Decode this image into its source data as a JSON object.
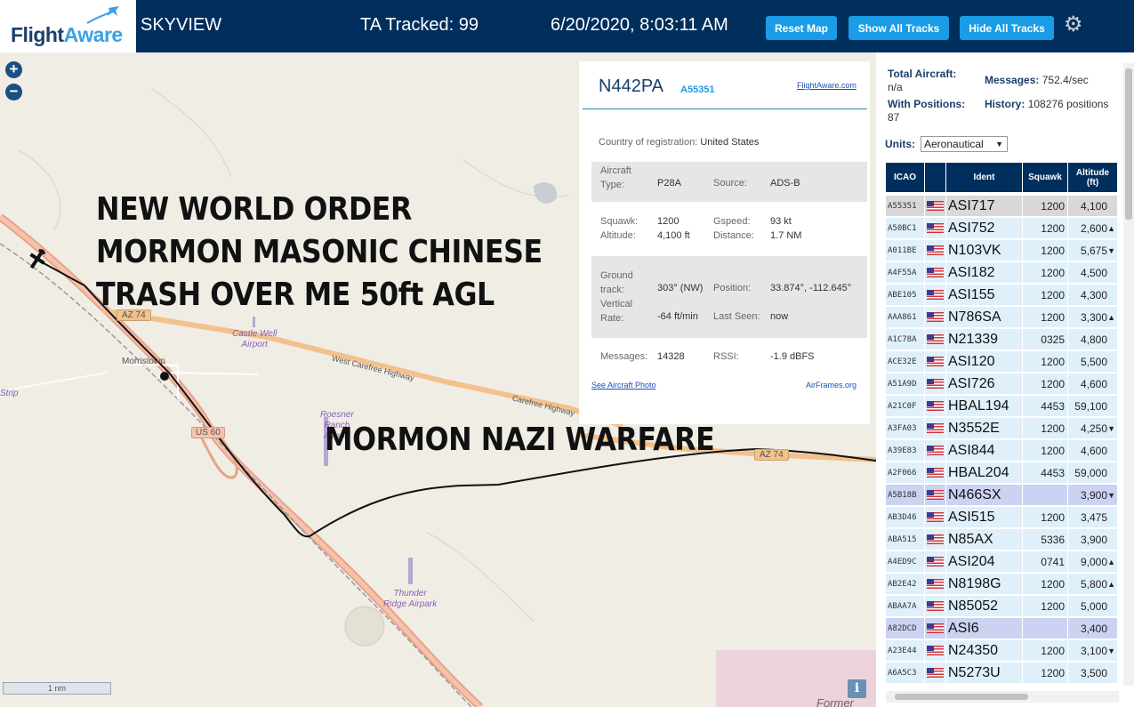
{
  "header": {
    "logo_part1": "Flight",
    "logo_part2": "Aware",
    "app_title": "SKYVIEW",
    "tracked": "TA Tracked: 99",
    "clock": "6/20/2020, 8:03:11 AM",
    "reset_label": "Reset Map",
    "show_label": "Show All Tracks",
    "hide_label": "Hide All Tracks",
    "settings_icon": "gear-icon",
    "colors": {
      "bar": "#002f5d",
      "button": "#1b9ce6"
    }
  },
  "map": {
    "zoom_in": "+",
    "zoom_out": "−",
    "place_morristown": "Morristown",
    "place_strip": "Strip",
    "place_former": "Former",
    "road_az74_a": "AZ 74",
    "road_az74_b": "AZ 74",
    "road_us60": "US 60",
    "road_carefree": "West Carefree Highway",
    "road_carefree2": "Carefree Highway",
    "airport_castle": [
      "Castle Well",
      "Airport"
    ],
    "airport_roesner": [
      "Roesner",
      "Ranch",
      "Airport"
    ],
    "airport_thunder": [
      "Thunder",
      "Ridge Airpark"
    ],
    "scale": "1 nm",
    "info": "i",
    "overlay_lines": [
      "NEW WORLD ORDER",
      "MORMON MASONIC CHINESE",
      "TRASH OVER ME 50ft AGL"
    ],
    "overlay_warfare": "MORMON NAZI WARFARE"
  },
  "popup": {
    "ident": "N442PA",
    "icao": "A55351",
    "fa_link": "FlightAware.com",
    "country_label": "Country of registration:",
    "country": "United States",
    "aircraft_label1": "Aircraft",
    "aircraft_label2": "Type:",
    "aircraft_type": "P28A",
    "source_label": "Source:",
    "source": "ADS-B",
    "squawk_label": "Squawk:",
    "squawk": "1200",
    "gspeed_label": "Gspeed:",
    "gspeed": "93 kt",
    "altitude_label": "Altitude:",
    "altitude": "4,100 ft",
    "distance_label": "Distance:",
    "distance": "1.7 NM",
    "ground_label1": "Ground",
    "ground_label2": "track:",
    "track": "303° (NW)",
    "position_label": "Position:",
    "position": "33.874°, -112.645°",
    "vertical_label1": "Vertical",
    "vertical_label2": "Rate:",
    "vrate": "-64 ft/min",
    "last_seen_label": "Last Seen:",
    "last_seen": "now",
    "messages_label": "Messages:",
    "messages": "14328",
    "rssi_label": "RSSI:",
    "rssi": "-1.9 dBFS",
    "photo_link": "See Aircraft Photo",
    "airframes_link": "AirFrames.org"
  },
  "panel": {
    "total_label": "Total Aircraft:",
    "total_value": "n/a",
    "with_pos_label": "With Positions:",
    "with_pos_value": "87",
    "messages_label": "Messages:",
    "messages_value": "752.4/sec",
    "history_label": "History:",
    "history_value": "108276 positions",
    "units_label": "Units:",
    "units_value": "Aeronautical",
    "columns": [
      "ICAO",
      "",
      "Ident",
      "Squawk",
      "Altitude (ft)"
    ],
    "rows": [
      {
        "icao": "A55351",
        "ident": "ASI717",
        "squawk": "1200",
        "alt": "4,100",
        "trend": "",
        "state": "sel"
      },
      {
        "icao": "A50BC1",
        "ident": "ASI752",
        "squawk": "1200",
        "alt": "2,600",
        "trend": "▲",
        "state": ""
      },
      {
        "icao": "A011BE",
        "ident": "N103VK",
        "squawk": "1200",
        "alt": "5,675",
        "trend": "▼",
        "state": ""
      },
      {
        "icao": "A4F55A",
        "ident": "ASI182",
        "squawk": "1200",
        "alt": "4,500",
        "trend": "",
        "state": ""
      },
      {
        "icao": "ABE105",
        "ident": "ASI155",
        "squawk": "1200",
        "alt": "4,300",
        "trend": "",
        "state": ""
      },
      {
        "icao": "AAA861",
        "ident": "N786SA",
        "squawk": "1200",
        "alt": "3,300",
        "trend": "▲",
        "state": ""
      },
      {
        "icao": "A1C78A",
        "ident": "N21339",
        "squawk": "0325",
        "alt": "4,800",
        "trend": "",
        "state": ""
      },
      {
        "icao": "ACE32E",
        "ident": "ASI120",
        "squawk": "1200",
        "alt": "5,500",
        "trend": "",
        "state": ""
      },
      {
        "icao": "A51A9D",
        "ident": "ASI726",
        "squawk": "1200",
        "alt": "4,600",
        "trend": "",
        "state": ""
      },
      {
        "icao": "A21C0F",
        "ident": "HBAL194",
        "squawk": "4453",
        "alt": "59,100",
        "trend": "",
        "state": ""
      },
      {
        "icao": "A3FA03",
        "ident": "N3552E",
        "squawk": "1200",
        "alt": "4,250",
        "trend": "▼",
        "state": ""
      },
      {
        "icao": "A39E83",
        "ident": "ASI844",
        "squawk": "1200",
        "alt": "4,600",
        "trend": "",
        "state": ""
      },
      {
        "icao": "A2F066",
        "ident": "HBAL204",
        "squawk": "4453",
        "alt": "59,000",
        "trend": "",
        "state": ""
      },
      {
        "icao": "A5B18B",
        "ident": "N466SX",
        "squawk": "",
        "alt": "3,900",
        "trend": "▼",
        "state": "hl"
      },
      {
        "icao": "AB3D46",
        "ident": "ASI515",
        "squawk": "1200",
        "alt": "3,475",
        "trend": "",
        "state": ""
      },
      {
        "icao": "ABA515",
        "ident": "N85AX",
        "squawk": "5336",
        "alt": "3,900",
        "trend": "",
        "state": ""
      },
      {
        "icao": "A4ED9C",
        "ident": "ASI204",
        "squawk": "0741",
        "alt": "9,000",
        "trend": "▲",
        "state": ""
      },
      {
        "icao": "AB2E42",
        "ident": "N8198G",
        "squawk": "1200",
        "alt": "5,800",
        "trend": "▲",
        "state": ""
      },
      {
        "icao": "ABAA7A",
        "ident": "N85052",
        "squawk": "1200",
        "alt": "5,000",
        "trend": "",
        "state": ""
      },
      {
        "icao": "A82DCD",
        "ident": "ASI6",
        "squawk": "",
        "alt": "3,400",
        "trend": "",
        "state": "hl"
      },
      {
        "icao": "A23E44",
        "ident": "N24350",
        "squawk": "1200",
        "alt": "3,100",
        "trend": "▼",
        "state": ""
      },
      {
        "icao": "A6A5C3",
        "ident": "N5273U",
        "squawk": "1200",
        "alt": "3,500",
        "trend": "",
        "state": ""
      }
    ]
  }
}
